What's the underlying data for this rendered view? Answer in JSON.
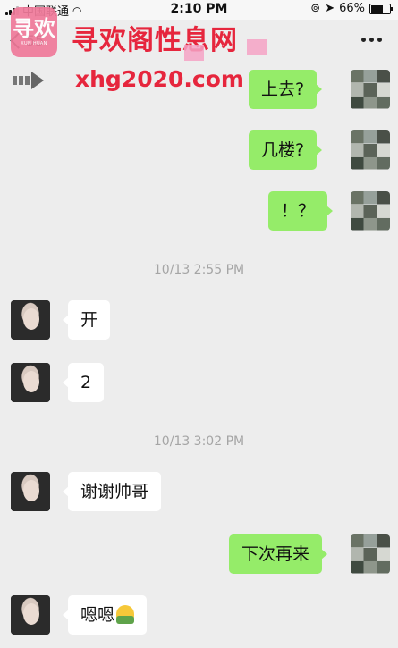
{
  "status_bar": {
    "carrier": "中国联通",
    "time": "2:10 PM",
    "battery": "66%",
    "battery_level": 0.66
  },
  "nav": {
    "back_count": "55"
  },
  "watermark": {
    "title": "寻欢阁性息网",
    "url": "xhg2020.com",
    "logo_glyph": "寻欢",
    "logo_sub": "XUN HUAN"
  },
  "messages": [
    {
      "side": "out",
      "text": "上去?"
    },
    {
      "side": "out",
      "text": "几楼?"
    },
    {
      "side": "out",
      "text": "！？"
    },
    {
      "type": "time",
      "text": "10/13 2:55 PM"
    },
    {
      "side": "in",
      "text": "开"
    },
    {
      "side": "in",
      "text": "2"
    },
    {
      "type": "time",
      "text": "10/13 3:02 PM"
    },
    {
      "side": "in",
      "text": "谢谢帅哥"
    },
    {
      "side": "out",
      "text": "下次再来"
    },
    {
      "side": "in",
      "text": "嗯嗯",
      "emoji": "ok-emoji-icon"
    }
  ],
  "colors": {
    "background": "#ededed",
    "outgoing_bubble": "#95ec69",
    "incoming_bubble": "#ffffff",
    "watermark_red": "#e6263d",
    "logo_pink": "#f07a9a"
  }
}
